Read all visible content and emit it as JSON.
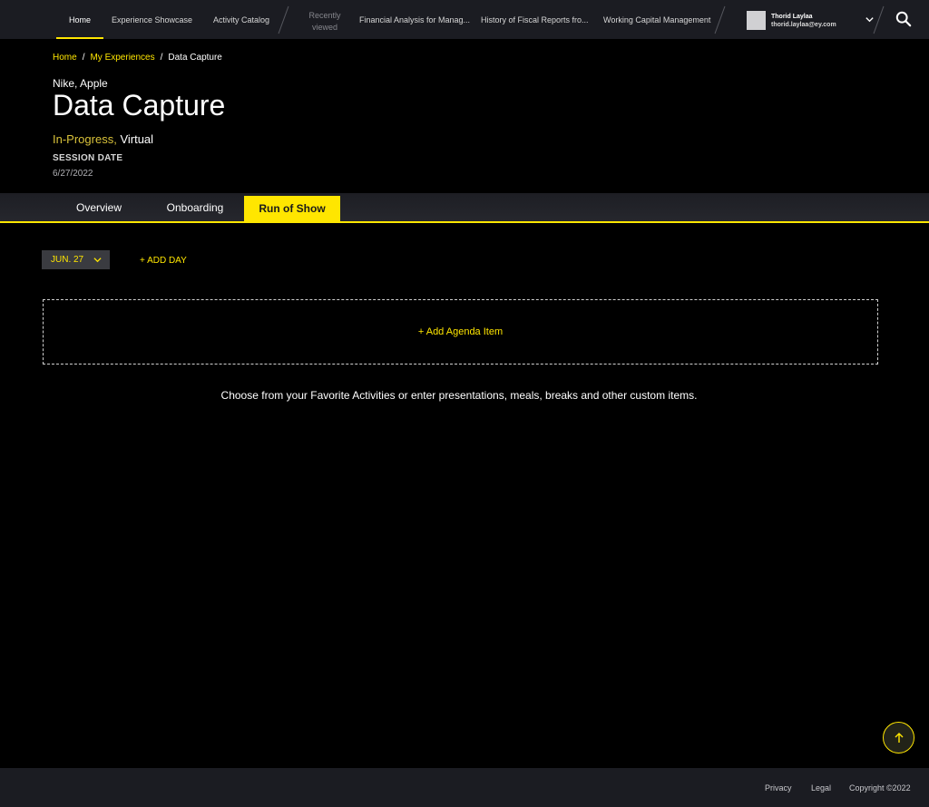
{
  "nav": {
    "items": [
      {
        "label": "Home"
      },
      {
        "label": "Experience Showcase"
      },
      {
        "label": "Activity Catalog"
      }
    ],
    "recently_viewed_label": "Recently viewed",
    "recent": [
      {
        "label": "Financial Analysis for Manag..."
      },
      {
        "label": "History of Fiscal Reports fro..."
      },
      {
        "label": "Working Capital Management"
      }
    ],
    "user": {
      "name": "Thorid Laylaa",
      "email": "thorid.laylaa@ey.com"
    }
  },
  "breadcrumb": {
    "home": "Home",
    "sep": "/",
    "experiences": "My Experiences",
    "current": "Data Capture"
  },
  "header": {
    "clients": "Nike, Apple",
    "title": "Data Capture",
    "status": "In-Progress,",
    "mode": "Virtual",
    "session_label": "SESSION DATE",
    "session_date": "6/27/2022"
  },
  "tabs": [
    {
      "label": "Overview"
    },
    {
      "label": "Onboarding"
    },
    {
      "label": "Run of Show"
    }
  ],
  "day_select": {
    "value": "JUN. 27"
  },
  "add_day_label": "+ ADD DAY",
  "agenda": {
    "add_label": "+ Add Agenda Item",
    "hint": "Choose from your Favorite Activities or enter presentations, meals, breaks and other custom items."
  },
  "footer": {
    "privacy": "Privacy",
    "legal": "Legal",
    "copyright": "Copyright ©2022"
  },
  "colors": {
    "accent": "#ffe600",
    "nav_bg": "#1b1c22",
    "page_bg": "#000000"
  }
}
